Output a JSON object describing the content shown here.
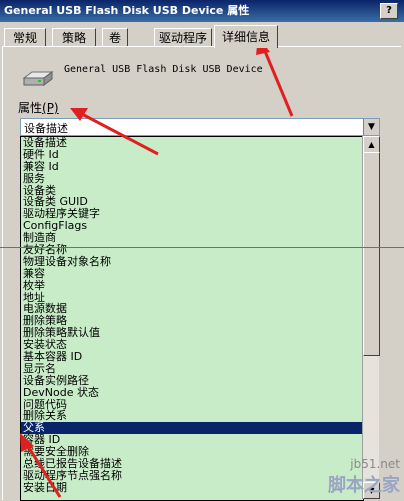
{
  "window": {
    "title": "General USB Flash Disk USB Device 属性",
    "help_label": "?"
  },
  "tabs": [
    {
      "label": "常规"
    },
    {
      "label": "策略"
    },
    {
      "label": "卷"
    },
    {
      "label": "驱动程序"
    },
    {
      "label": "详细信息"
    }
  ],
  "device": {
    "name": "General USB Flash Disk USB Device",
    "icon": "usb-drive-icon"
  },
  "properties": {
    "label": "属性",
    "accel": "(P)",
    "selected": "设备描述",
    "items": [
      "设备描述",
      "硬件 Id",
      "兼容 Id",
      "服务",
      "设备类",
      "设备类 GUID",
      "驱动程序关键字",
      "ConfigFlags",
      "制造商",
      "友好名称",
      "物理设备对象名称",
      "兼容",
      "枚举",
      "地址",
      "电源数据",
      "删除策略",
      "删除策略默认值",
      "安装状态",
      "基本容器 ID",
      "显示名",
      "设备实例路径",
      "DevNode 状态",
      "问题代码",
      "删除关系",
      "父系",
      "容器 ID",
      "需要安全删除",
      "总线已报告设备描述",
      "驱动程序节点强名称",
      "安装日期"
    ],
    "highlighted_index": 24
  },
  "colors": {
    "list_background": "#c8ecc8",
    "selection": "#0a246a",
    "arrow": "#e02020"
  },
  "watermark": {
    "site": "jb51.net",
    "name": "脚本之家"
  }
}
